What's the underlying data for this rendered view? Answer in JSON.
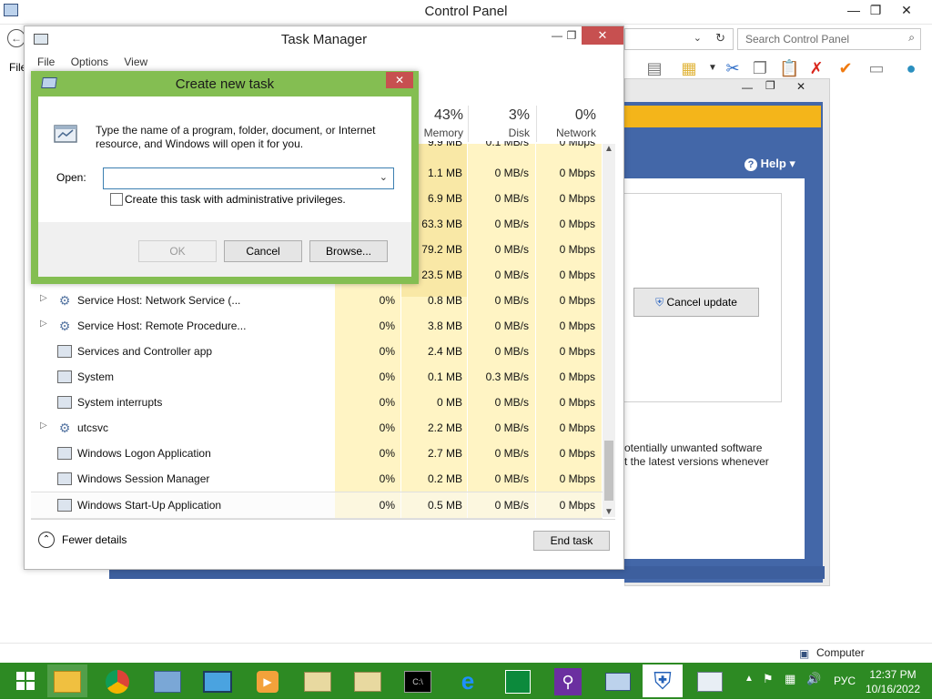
{
  "control_panel": {
    "title": "Control Panel",
    "menu_partial": "File",
    "search_placeholder": "Search Control Panel",
    "status_text": "Computer",
    "controls": {
      "minimize": "—",
      "maximize": "❐",
      "close": "✕"
    }
  },
  "background_window": {
    "help_label": "Help ▾",
    "cancel_update_label": "Cancel update",
    "text_line1": "otentially unwanted software",
    "text_line2": "t the latest versions whenever"
  },
  "task_manager": {
    "title": "Task Manager",
    "menu": [
      "File",
      "Options",
      "View"
    ],
    "columns": {
      "memory": {
        "percent": "43%",
        "label": "Memory"
      },
      "disk": {
        "percent": "3%",
        "label": "Disk"
      },
      "network": {
        "percent": "0%",
        "label": "Network"
      }
    },
    "partial_rows": [
      {
        "mem": "9.9 MB",
        "disk": "0.1 MB/s",
        "net": "0 Mbps"
      },
      {
        "mem": "1.1 MB",
        "disk": "0 MB/s",
        "net": "0 Mbps"
      },
      {
        "mem": "6.9 MB",
        "disk": "0 MB/s",
        "net": "0 Mbps"
      },
      {
        "mem": "63.3 MB",
        "disk": "0 MB/s",
        "net": "0 Mbps"
      },
      {
        "mem": "79.2 MB",
        "disk": "0 MB/s",
        "net": "0 Mbps"
      },
      {
        "mem": "23.5 MB",
        "disk": "0 MB/s",
        "net": "0 Mbps"
      }
    ],
    "rows": [
      {
        "name": "Service Host: Network Service (...",
        "expandable": true,
        "icon": "gear-icon",
        "cpu": "0%",
        "mem": "0.8 MB",
        "disk": "0 MB/s",
        "net": "0 Mbps"
      },
      {
        "name": "Service Host: Remote Procedure...",
        "expandable": true,
        "icon": "gear-icon",
        "cpu": "0%",
        "mem": "3.8 MB",
        "disk": "0 MB/s",
        "net": "0 Mbps"
      },
      {
        "name": "Services and Controller app",
        "expandable": false,
        "icon": "window-icon",
        "cpu": "0%",
        "mem": "2.4 MB",
        "disk": "0 MB/s",
        "net": "0 Mbps"
      },
      {
        "name": "System",
        "expandable": false,
        "icon": "window-icon",
        "cpu": "0%",
        "mem": "0.1 MB",
        "disk": "0.3 MB/s",
        "net": "0 Mbps"
      },
      {
        "name": "System interrupts",
        "expandable": false,
        "icon": "window-icon",
        "cpu": "0%",
        "mem": "0 MB",
        "disk": "0 MB/s",
        "net": "0 Mbps"
      },
      {
        "name": "utcsvc",
        "expandable": true,
        "icon": "gear-icon",
        "cpu": "0%",
        "mem": "2.2 MB",
        "disk": "0 MB/s",
        "net": "0 Mbps"
      },
      {
        "name": "Windows Logon Application",
        "expandable": false,
        "icon": "window-icon",
        "cpu": "0%",
        "mem": "2.7 MB",
        "disk": "0 MB/s",
        "net": "0 Mbps"
      },
      {
        "name": "Windows Session Manager",
        "expandable": false,
        "icon": "window-icon",
        "cpu": "0%",
        "mem": "0.2 MB",
        "disk": "0 MB/s",
        "net": "0 Mbps"
      },
      {
        "name": "Windows Start-Up Application",
        "expandable": false,
        "icon": "window-icon",
        "cpu": "0%",
        "mem": "0.5 MB",
        "disk": "0 MB/s",
        "net": "0 Mbps"
      }
    ],
    "fewer_details_label": "Fewer details",
    "end_task_label": "End task"
  },
  "dialog": {
    "title": "Create new task",
    "description": "Type the name of a program, folder, document, or Internet resource, and Windows will open it for you.",
    "open_label": "Open:",
    "open_value": "",
    "admin_checkbox_label": "Create this task with administrative privileges.",
    "admin_checked": false,
    "ok_label": "OK",
    "cancel_label": "Cancel",
    "browse_label": "Browse...",
    "close_glyph": "✕"
  },
  "taskbar": {
    "apps": [
      "file-explorer-icon",
      "chrome-icon",
      "control-panel-icon",
      "computer-icon",
      "media-player-icon",
      "search-folder-icon",
      "search-folder-icon",
      "cmd-icon",
      "internet-explorer-icon",
      "store-icon",
      "magnifier-icon",
      "task-manager-icon",
      "defender-icon",
      "task-manager-graph-icon"
    ],
    "language": "РУС",
    "time": "12:37 PM",
    "date": "10/16/2022",
    "accent": "#2d8a23"
  }
}
